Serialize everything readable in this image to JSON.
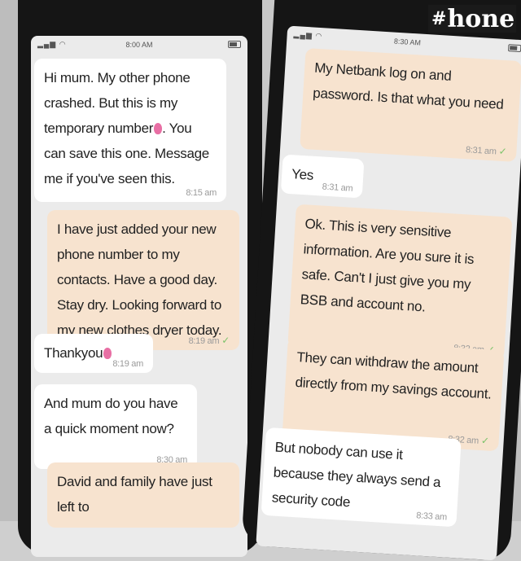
{
  "brand": {
    "logo_text": "hone"
  },
  "left_phone": {
    "status_time": "8:00 AM",
    "messages": [
      {
        "dir": "in",
        "text": "Hi mum. My other phone crashed. But this is my temporary number",
        "text_after": ". You can save this one. Message me if you've seen this.",
        "emoji": true,
        "time": "8:15 am"
      },
      {
        "dir": "out",
        "text": "I have just added your new phone number to my contacts. Have a good day. Stay dry. Looking forward to my new clothes dryer today.",
        "time": "8:19 am",
        "read": "✓"
      },
      {
        "dir": "in",
        "text": "Thankyou",
        "emoji": true,
        "time": "8:19 am"
      },
      {
        "dir": "in",
        "text": "And mum do you have a quick moment now?",
        "time": "8:30 am"
      },
      {
        "dir": "out",
        "text": "David and family have just left to"
      }
    ]
  },
  "right_phone": {
    "status_time": "8:30 AM",
    "messages": [
      {
        "dir": "out",
        "text": "My Netbank log on and password. Is that what you need",
        "time": "8:31 am",
        "read": "✓"
      },
      {
        "dir": "in",
        "text": "Yes",
        "time": "8:31 am"
      },
      {
        "dir": "out",
        "text": "Ok. This is very sensitive information. Are you sure it is safe. Can't I just give you my BSB and account no.",
        "time": "8:32 am",
        "read": "✓"
      },
      {
        "dir": "out",
        "text": "They can withdraw the amount directly from my savings account.",
        "time": "8:32 am",
        "read": "✓"
      },
      {
        "dir": "in",
        "text": "But nobody can use it because they always send a security code",
        "time": "8:33 am"
      }
    ]
  }
}
